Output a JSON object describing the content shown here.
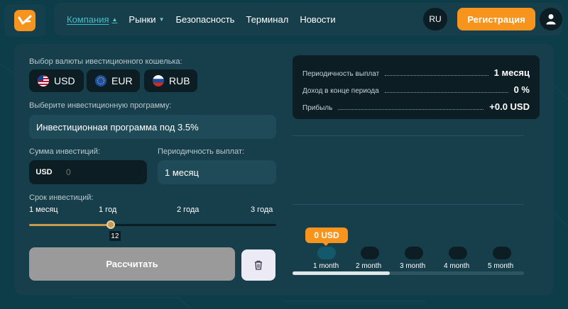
{
  "nav": {
    "items": [
      {
        "label": "Компания",
        "has_dropdown": true,
        "active": true
      },
      {
        "label": "Рынки",
        "has_dropdown": true,
        "active": false
      },
      {
        "label": "Безопасность",
        "has_dropdown": false,
        "active": false
      },
      {
        "label": "Терминал",
        "has_dropdown": false,
        "active": false
      },
      {
        "label": "Новости",
        "has_dropdown": false,
        "active": false
      }
    ],
    "language": "RU",
    "register_label": "Регистрация"
  },
  "colors": {
    "accent": "#f7941d",
    "link_active": "#3fc0c8",
    "panel": "#173e4b",
    "dark": "#0d1d24"
  },
  "form": {
    "currency_label": "Выбор валюты ивестиционного кошелька:",
    "currencies": [
      {
        "code": "USD",
        "icon": "us-flag-icon"
      },
      {
        "code": "EUR",
        "icon": "eu-flag-icon"
      },
      {
        "code": "RUB",
        "icon": "ru-flag-icon"
      }
    ],
    "program_label": "Выберите инвестиционную программу:",
    "program_value": "Инвестиционная программа под 3.5%",
    "amount_label": "Сумма инвестиций:",
    "amount_currency": "USD",
    "amount_placeholder": "0",
    "period_label": "Периодичность выплат:",
    "period_value": "1 месяц",
    "term_label": "Срок инвестиций:",
    "term_ticks": [
      "1 месяц",
      "1 год",
      "2 года",
      "3 года"
    ],
    "term_value": "12",
    "term_fraction": 0.33,
    "calculate_label": "Рассчитать"
  },
  "summary": {
    "rows": [
      {
        "label": "Периодичность выплат",
        "value": "1 месяц"
      },
      {
        "label": "Доход в конце периода",
        "value": "0 %"
      },
      {
        "label": "Прибыль",
        "value": "+0.0 USD"
      }
    ]
  },
  "chart": {
    "tooltip": "0 USD",
    "months": [
      "1 month",
      "2 month",
      "3 month",
      "4 month",
      "5 month"
    ],
    "scroll_fraction": 0.42
  }
}
